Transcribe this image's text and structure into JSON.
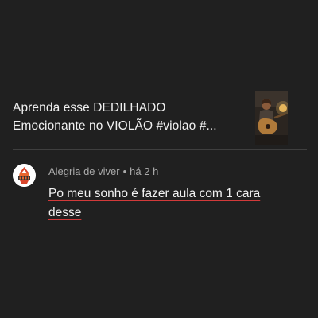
{
  "video": {
    "title_line1": "Aprenda esse DEDILHADO",
    "title_line2": "Emocionante no VIOLÃO #violao #..."
  },
  "comment": {
    "author": "Alegria de viver",
    "separator": "•",
    "time": "há 2 h",
    "text_line1": "Po meu sonho é fazer aula com 1 cara",
    "text_line2": "desse"
  },
  "colors": {
    "background": "#202020",
    "primary_text": "#f1f1f1",
    "secondary_text": "#aaaaaa",
    "divider": "#3f3f3f",
    "spellcheck_underline": "#d23a3a"
  }
}
